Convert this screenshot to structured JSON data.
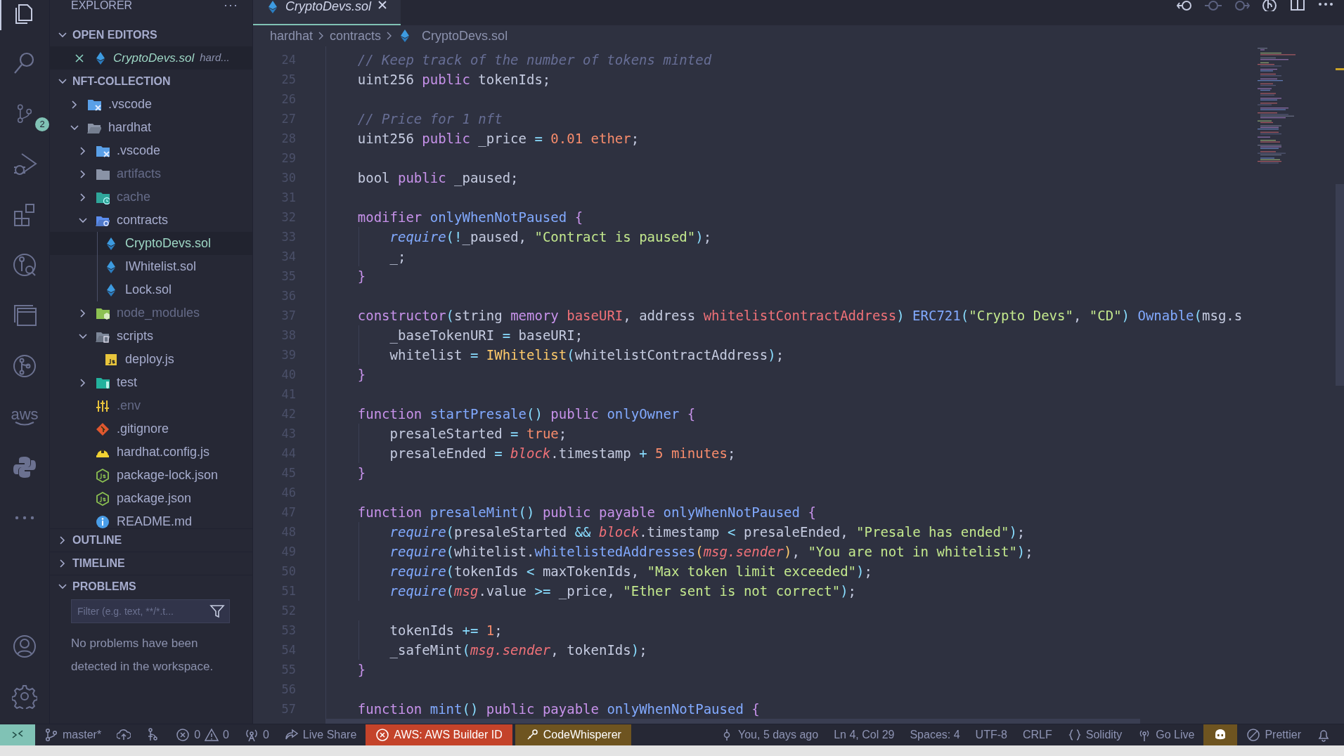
{
  "activity_bar": {
    "top": [
      {
        "kind": "explorer",
        "selected": true
      },
      {
        "kind": "search",
        "selected": false
      },
      {
        "kind": "scm",
        "selected": false,
        "badge": "2"
      },
      {
        "kind": "debug",
        "selected": false
      },
      {
        "kind": "extensions",
        "selected": false
      },
      {
        "kind": "remote",
        "selected": false
      },
      {
        "kind": "windows",
        "selected": false
      },
      {
        "kind": "graph",
        "selected": false
      },
      {
        "kind": "aws",
        "selected": false,
        "label": "aws"
      },
      {
        "kind": "python",
        "selected": false
      },
      {
        "kind": "more",
        "selected": false
      }
    ],
    "bottom": [
      {
        "kind": "account"
      },
      {
        "kind": "settings"
      }
    ]
  },
  "sidebar": {
    "title": "EXPLORER",
    "more": "···",
    "open_editors": {
      "title": "OPEN EDITORS",
      "expanded": true,
      "items": [
        {
          "name": "CryptoDevs.sol",
          "description": "hard...",
          "kind": "solidity",
          "git_added": true
        }
      ]
    },
    "folder": {
      "title": "NFT-COLLECTION",
      "expanded": true,
      "items": [
        {
          "name": ".vscode",
          "kind": "vscodefolder",
          "expanded": false,
          "selected": false,
          "dimmed": false,
          "git_added": false
        },
        {
          "name": "hardhat",
          "kind": "folder",
          "expanded": true,
          "selected": false,
          "dimmed": false,
          "git_added": false,
          "children": [
            {
              "name": ".vscode",
              "kind": "vscodefolder",
              "expanded": false,
              "selected": false,
              "dimmed": false,
              "git_added": false
            },
            {
              "name": "artifacts",
              "kind": "folder",
              "expanded": false,
              "selected": false,
              "dimmed": true,
              "git_added": false
            },
            {
              "name": "cache",
              "kind": "cachefolder",
              "expanded": false,
              "selected": false,
              "dimmed": true,
              "git_added": false
            },
            {
              "name": "contracts",
              "kind": "contractsfolder",
              "expanded": true,
              "selected": false,
              "dimmed": false,
              "git_added": false,
              "children": [
                {
                  "name": "CryptoDevs.sol",
                  "kind": "solidity",
                  "selected": true,
                  "dimmed": false,
                  "git_added": true
                },
                {
                  "name": "IWhitelist.sol",
                  "kind": "solidity",
                  "selected": false,
                  "dimmed": false,
                  "git_added": false
                },
                {
                  "name": "Lock.sol",
                  "kind": "solidity",
                  "selected": false,
                  "dimmed": false,
                  "git_added": false
                }
              ]
            },
            {
              "name": "node_modules",
              "kind": "nodefolder",
              "expanded": false,
              "selected": false,
              "dimmed": true,
              "git_added": false
            },
            {
              "name": "scripts",
              "kind": "scriptsfolder",
              "expanded": true,
              "selected": false,
              "dimmed": false,
              "git_added": false,
              "children": [
                {
                  "name": "deploy.js",
                  "kind": "javascript",
                  "selected": false,
                  "dimmed": false,
                  "git_added": false
                }
              ]
            },
            {
              "name": "test",
              "kind": "testfolder",
              "expanded": false,
              "selected": false,
              "dimmed": false,
              "git_added": false
            },
            {
              "name": ".env",
              "kind": "env",
              "selected": false,
              "dimmed": true,
              "git_added": false
            },
            {
              "name": ".gitignore",
              "kind": "git",
              "selected": false,
              "dimmed": false,
              "git_added": false
            },
            {
              "name": "hardhat.config.js",
              "kind": "hardhat",
              "selected": false,
              "dimmed": false,
              "git_added": false
            },
            {
              "name": "package-lock.json",
              "kind": "json",
              "selected": false,
              "dimmed": false,
              "git_added": false
            },
            {
              "name": "package.json",
              "kind": "json",
              "selected": false,
              "dimmed": false,
              "git_added": false
            },
            {
              "name": "README.md",
              "kind": "readme",
              "selected": false,
              "dimmed": false,
              "git_added": false
            }
          ]
        }
      ]
    },
    "sections": [
      {
        "title": "OUTLINE",
        "expanded": false
      },
      {
        "title": "TIMELINE",
        "expanded": false
      },
      {
        "title": "PROBLEMS",
        "expanded": true
      }
    ],
    "problems": {
      "filter_placeholder": "Filter (e.g. text, **/*.t...",
      "message": "No problems have been detected in the workspace."
    }
  },
  "editor": {
    "tabs": [
      {
        "label": "CryptoDevs.sol",
        "kind": "solidity",
        "selected": true,
        "preview": true
      }
    ],
    "actions": [
      {
        "kind": "back",
        "disabled": false
      },
      {
        "kind": "dot",
        "disabled": true
      },
      {
        "kind": "forward",
        "disabled": true
      },
      {
        "kind": "timeline",
        "disabled": false
      },
      {
        "kind": "split",
        "disabled": false
      },
      {
        "kind": "more",
        "disabled": false
      }
    ],
    "breadcrumb": [
      {
        "label": "hardhat",
        "kind": "folder"
      },
      {
        "label": "contracts",
        "kind": "folder"
      },
      {
        "label": "CryptoDevs.sol",
        "kind": "solidity"
      }
    ],
    "lines": [
      {
        "number": "24",
        "tokens": [
          {
            "kind": "comment",
            "text": "    // Keep track of the number of tokens minted"
          }
        ]
      },
      {
        "number": "25",
        "tokens": [
          {
            "kind": "plain",
            "text": "    uint256 "
          },
          {
            "kind": "keyword",
            "text": "public"
          },
          {
            "kind": "plain",
            "text": " tokenIds;"
          }
        ]
      },
      {
        "number": "26"
      },
      {
        "number": "27",
        "tokens": [
          {
            "kind": "comment",
            "text": "    // Price for 1 nft"
          }
        ]
      },
      {
        "number": "28",
        "tokens": [
          {
            "kind": "plain",
            "text": "    uint256 "
          },
          {
            "kind": "keyword",
            "text": "public"
          },
          {
            "kind": "plain",
            "text": " _price "
          },
          {
            "kind": "operator",
            "text": "="
          },
          {
            "kind": "number",
            "text": " 0.01 ether"
          },
          {
            "kind": "plain",
            "text": ";"
          }
        ]
      },
      {
        "number": "29"
      },
      {
        "number": "30",
        "tokens": [
          {
            "kind": "plain",
            "text": "    bool "
          },
          {
            "kind": "keyword",
            "text": "public"
          },
          {
            "kind": "plain",
            "text": " _paused;"
          }
        ]
      },
      {
        "number": "31"
      },
      {
        "number": "32",
        "tokens": [
          {
            "kind": "keyword",
            "text": "    modifier "
          },
          {
            "kind": "function",
            "text": "onlyWhenNotPaused "
          },
          {
            "kind": "brace",
            "text": "{"
          }
        ]
      },
      {
        "number": "33",
        "tokens": [
          {
            "kind": "call",
            "text": "        require"
          },
          {
            "kind": "paren",
            "text": "("
          },
          {
            "kind": "operator",
            "text": "!"
          },
          {
            "kind": "plain",
            "text": "_paused, "
          },
          {
            "kind": "string",
            "text": "\"Contract is paused\""
          },
          {
            "kind": "paren",
            "text": ")"
          },
          {
            "kind": "plain",
            "text": ";"
          }
        ]
      },
      {
        "number": "34",
        "tokens": [
          {
            "kind": "plain",
            "text": "        _;"
          }
        ]
      },
      {
        "number": "35",
        "tokens": [
          {
            "kind": "brace",
            "text": "    }"
          }
        ]
      },
      {
        "number": "36"
      },
      {
        "number": "37",
        "tokens": [
          {
            "kind": "keyword",
            "text": "    constructor"
          },
          {
            "kind": "paren",
            "text": "("
          },
          {
            "kind": "plain",
            "text": "string "
          },
          {
            "kind": "keyword",
            "text": "memory "
          },
          {
            "kind": "param",
            "text": "baseURI"
          },
          {
            "kind": "plain",
            "text": ", address "
          },
          {
            "kind": "param",
            "text": "whitelistContractAddress"
          },
          {
            "kind": "paren",
            "text": ")"
          },
          {
            "kind": "function",
            "text": " ERC721"
          },
          {
            "kind": "paren",
            "text": "("
          },
          {
            "kind": "string",
            "text": "\"Crypto Devs\""
          },
          {
            "kind": "plain",
            "text": ", "
          },
          {
            "kind": "string",
            "text": "\"CD\""
          },
          {
            "kind": "paren",
            "text": ")"
          },
          {
            "kind": "function",
            "text": " Ownable"
          },
          {
            "kind": "paren",
            "text": "("
          },
          {
            "kind": "plain",
            "text": "msg.s"
          }
        ]
      },
      {
        "number": "38",
        "tokens": [
          {
            "kind": "plain",
            "text": "        _baseTokenURI "
          },
          {
            "kind": "operator",
            "text": "="
          },
          {
            "kind": "plain",
            "text": " baseURI;"
          }
        ]
      },
      {
        "number": "39",
        "tokens": [
          {
            "kind": "plain",
            "text": "        whitelist "
          },
          {
            "kind": "operator",
            "text": "="
          },
          {
            "kind": "class",
            "text": " IWhitelist"
          },
          {
            "kind": "paren",
            "text": "("
          },
          {
            "kind": "plain",
            "text": "whitelistContractAddress"
          },
          {
            "kind": "paren",
            "text": ")"
          },
          {
            "kind": "plain",
            "text": ";"
          }
        ]
      },
      {
        "number": "40",
        "tokens": [
          {
            "kind": "brace",
            "text": "    }"
          }
        ]
      },
      {
        "number": "41"
      },
      {
        "number": "42",
        "tokens": [
          {
            "kind": "keyword",
            "text": "    function "
          },
          {
            "kind": "function",
            "text": "startPresale"
          },
          {
            "kind": "paren",
            "text": "()"
          },
          {
            "kind": "keyword",
            "text": " public "
          },
          {
            "kind": "function",
            "text": "onlyOwner "
          },
          {
            "kind": "brace",
            "text": "{"
          }
        ]
      },
      {
        "number": "43",
        "tokens": [
          {
            "kind": "plain",
            "text": "        presaleStarted "
          },
          {
            "kind": "operator",
            "text": "="
          },
          {
            "kind": "number",
            "text": " true"
          },
          {
            "kind": "plain",
            "text": ";"
          }
        ]
      },
      {
        "number": "44",
        "tokens": [
          {
            "kind": "plain",
            "text": "        presaleEnded "
          },
          {
            "kind": "operator",
            "text": "="
          },
          {
            "kind": "builtin",
            "text": " block"
          },
          {
            "kind": "plain",
            "text": ".timestamp "
          },
          {
            "kind": "operator",
            "text": "+"
          },
          {
            "kind": "number",
            "text": " 5 minutes"
          },
          {
            "kind": "plain",
            "text": ";"
          }
        ]
      },
      {
        "number": "45",
        "tokens": [
          {
            "kind": "brace",
            "text": "    }"
          }
        ]
      },
      {
        "number": "46"
      },
      {
        "number": "47",
        "tokens": [
          {
            "kind": "keyword",
            "text": "    function "
          },
          {
            "kind": "function",
            "text": "presaleMint"
          },
          {
            "kind": "paren",
            "text": "()"
          },
          {
            "kind": "keyword",
            "text": " public payable "
          },
          {
            "kind": "function",
            "text": "onlyWhenNotPaused "
          },
          {
            "kind": "brace",
            "text": "{"
          }
        ]
      },
      {
        "number": "48",
        "tokens": [
          {
            "kind": "call",
            "text": "        require"
          },
          {
            "kind": "paren",
            "text": "("
          },
          {
            "kind": "plain",
            "text": "presaleStarted "
          },
          {
            "kind": "operator",
            "text": "&&"
          },
          {
            "kind": "builtin",
            "text": " block"
          },
          {
            "kind": "plain",
            "text": ".timestamp "
          },
          {
            "kind": "operator",
            "text": "<"
          },
          {
            "kind": "plain",
            "text": " presaleEnded, "
          },
          {
            "kind": "string",
            "text": "\"Presale has ended\""
          },
          {
            "kind": "paren",
            "text": ")"
          },
          {
            "kind": "plain",
            "text": ";"
          }
        ]
      },
      {
        "number": "49",
        "tokens": [
          {
            "kind": "call",
            "text": "        require"
          },
          {
            "kind": "paren",
            "text": "("
          },
          {
            "kind": "plain",
            "text": "whitelist."
          },
          {
            "kind": "function",
            "text": "whitelistedAddresses"
          },
          {
            "kind": "class",
            "text": "("
          },
          {
            "kind": "builtin",
            "text": "msg.sender"
          },
          {
            "kind": "class",
            "text": ")"
          },
          {
            "kind": "plain",
            "text": ", "
          },
          {
            "kind": "string",
            "text": "\"You are not in whitelist\""
          },
          {
            "kind": "paren",
            "text": ")"
          },
          {
            "kind": "plain",
            "text": ";"
          }
        ]
      },
      {
        "number": "50",
        "tokens": [
          {
            "kind": "call",
            "text": "        require"
          },
          {
            "kind": "paren",
            "text": "("
          },
          {
            "kind": "plain",
            "text": "tokenIds "
          },
          {
            "kind": "operator",
            "text": "<"
          },
          {
            "kind": "plain",
            "text": " maxTokenIds, "
          },
          {
            "kind": "string",
            "text": "\"Max token limit exceeded\""
          },
          {
            "kind": "paren",
            "text": ")"
          },
          {
            "kind": "plain",
            "text": ";"
          }
        ]
      },
      {
        "number": "51",
        "tokens": [
          {
            "kind": "call",
            "text": "        require"
          },
          {
            "kind": "paren",
            "text": "("
          },
          {
            "kind": "builtin",
            "text": "msg"
          },
          {
            "kind": "plain",
            "text": ".value "
          },
          {
            "kind": "operator",
            "text": ">="
          },
          {
            "kind": "plain",
            "text": " _price, "
          },
          {
            "kind": "string",
            "text": "\"Ether sent is not correct\""
          },
          {
            "kind": "paren",
            "text": ")"
          },
          {
            "kind": "plain",
            "text": ";"
          }
        ]
      },
      {
        "number": "52"
      },
      {
        "number": "53",
        "tokens": [
          {
            "kind": "plain",
            "text": "        tokenIds "
          },
          {
            "kind": "operator",
            "text": "+="
          },
          {
            "kind": "number",
            "text": " 1"
          },
          {
            "kind": "plain",
            "text": ";"
          }
        ]
      },
      {
        "number": "54",
        "tokens": [
          {
            "kind": "plain",
            "text": "        _safeMint"
          },
          {
            "kind": "paren",
            "text": "("
          },
          {
            "kind": "builtin",
            "text": "msg.sender"
          },
          {
            "kind": "plain",
            "text": ", tokenIds"
          },
          {
            "kind": "paren",
            "text": ")"
          },
          {
            "kind": "plain",
            "text": ";"
          }
        ]
      },
      {
        "number": "55",
        "tokens": [
          {
            "kind": "brace",
            "text": "    }"
          }
        ]
      },
      {
        "number": "56"
      },
      {
        "number": "57",
        "tokens": [
          {
            "kind": "keyword",
            "text": "    function "
          },
          {
            "kind": "function",
            "text": "mint"
          },
          {
            "kind": "paren",
            "text": "()"
          },
          {
            "kind": "keyword",
            "text": " public payable "
          },
          {
            "kind": "function",
            "text": "onlyWhenNotPaused "
          },
          {
            "kind": "brace",
            "text": "{"
          }
        ]
      }
    ]
  },
  "status_bar": {
    "left": [
      {
        "kind": "remote"
      },
      {
        "kind": "branch",
        "text": "master*"
      },
      {
        "kind": "sync"
      },
      {
        "kind": "graph"
      },
      {
        "kind": "problems",
        "errors": "0",
        "warnings": "0"
      },
      {
        "kind": "ports",
        "text": "0"
      },
      {
        "kind": "liveshare",
        "text": "Live Share"
      },
      {
        "kind": "aws",
        "text": "AWS: AWS Builder ID"
      },
      {
        "kind": "codewhisperer",
        "text": "CodeWhisperer"
      }
    ],
    "right": [
      {
        "kind": "blame",
        "text": "You, 5 days ago"
      },
      {
        "kind": "text",
        "text": "Ln 4, Col 29"
      },
      {
        "kind": "text",
        "text": "Spaces: 4"
      },
      {
        "kind": "text",
        "text": "UTF-8"
      },
      {
        "kind": "text",
        "text": "CRLF"
      },
      {
        "kind": "language",
        "text": "Solidity"
      },
      {
        "kind": "golive",
        "text": "Go Live"
      },
      {
        "kind": "copilot"
      },
      {
        "kind": "prettier",
        "text": "Prettier"
      },
      {
        "kind": "bell"
      }
    ]
  }
}
